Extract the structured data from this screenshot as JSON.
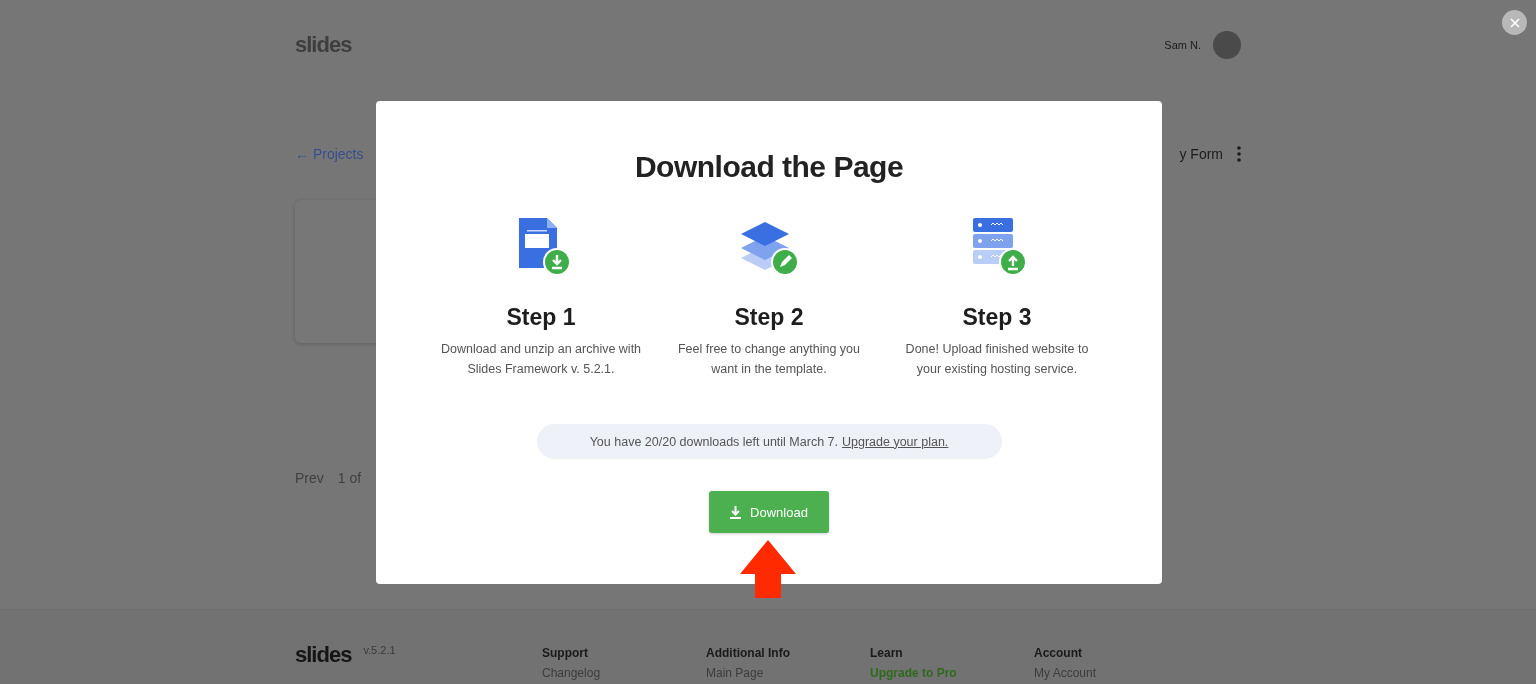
{
  "header": {
    "logo": "slides",
    "user_name": "Sam N."
  },
  "breadcrumb": {
    "back_link": "← Projects",
    "page_title": "y Form"
  },
  "pagination": {
    "prev": "Prev",
    "page": "1 of"
  },
  "modal": {
    "title": "Download the Page",
    "steps": [
      {
        "kind": "document",
        "title": "Step 1",
        "description": "Download and unzip an archive with Slides Framework v. 5.2.1."
      },
      {
        "kind": "layers",
        "title": "Step 2",
        "description": "Feel free to change anything you want in the template."
      },
      {
        "kind": "server",
        "title": "Step 3",
        "description": "Done! Upload finished website to your existing hosting service."
      }
    ],
    "notice": {
      "text": "You have 20/20 downloads left until March 7.",
      "link": "Upgrade your plan."
    },
    "button": "Download"
  },
  "footer": {
    "logo": "slides",
    "version": "v.5.2.1",
    "columns": [
      {
        "heading": "Support",
        "links": [
          {
            "label": "Changelog",
            "highlighted": false
          }
        ]
      },
      {
        "heading": "Additional Info",
        "links": [
          {
            "label": "Main Page",
            "highlighted": false
          }
        ]
      },
      {
        "heading": "Learn",
        "links": [
          {
            "label": "Upgrade to Pro",
            "highlighted": true
          }
        ]
      },
      {
        "heading": "Account",
        "links": [
          {
            "label": "My Account",
            "highlighted": false
          }
        ]
      }
    ]
  }
}
